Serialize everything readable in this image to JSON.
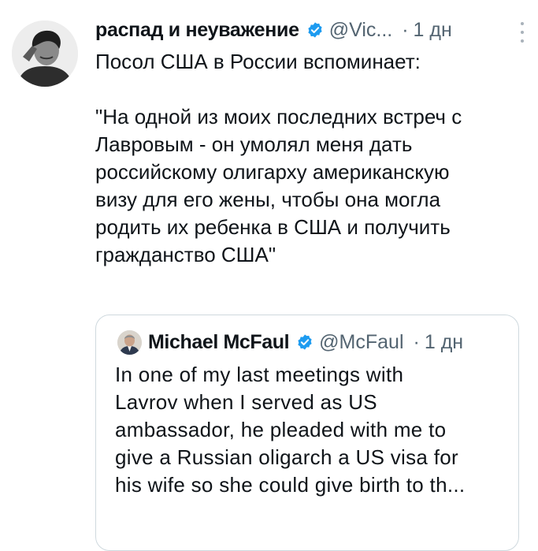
{
  "tweet": {
    "author": "распад и неуважение",
    "handle": "@Vic...",
    "separator": "·",
    "time": "1 дн",
    "lines": [
      "Посол США в России вспоминает:",
      "",
      "\"На одной из моих последних встреч с",
      "Лавровым - он умолял меня дать",
      "российскому олигарху американскую",
      "визу для его жены, чтобы она могла",
      "родить их ребенка в США и получить",
      "гражданство США\""
    ]
  },
  "quote": {
    "author": "Michael McFaul",
    "handle": "@McFaul",
    "separator": "·",
    "time": "1 дн",
    "lines": [
      "In one of my last meetings with",
      "Lavrov when I served as US",
      "ambassador, he pleaded with me to",
      "give a Russian oligarch a US visa for",
      "his wife so she could give birth to th..."
    ]
  },
  "colors": {
    "verified": "#1d9bf0",
    "secondary_text": "#536471",
    "border": "#cfd9de"
  },
  "icons": {
    "verified": "verified-badge-icon",
    "more": "more-options-icon"
  }
}
